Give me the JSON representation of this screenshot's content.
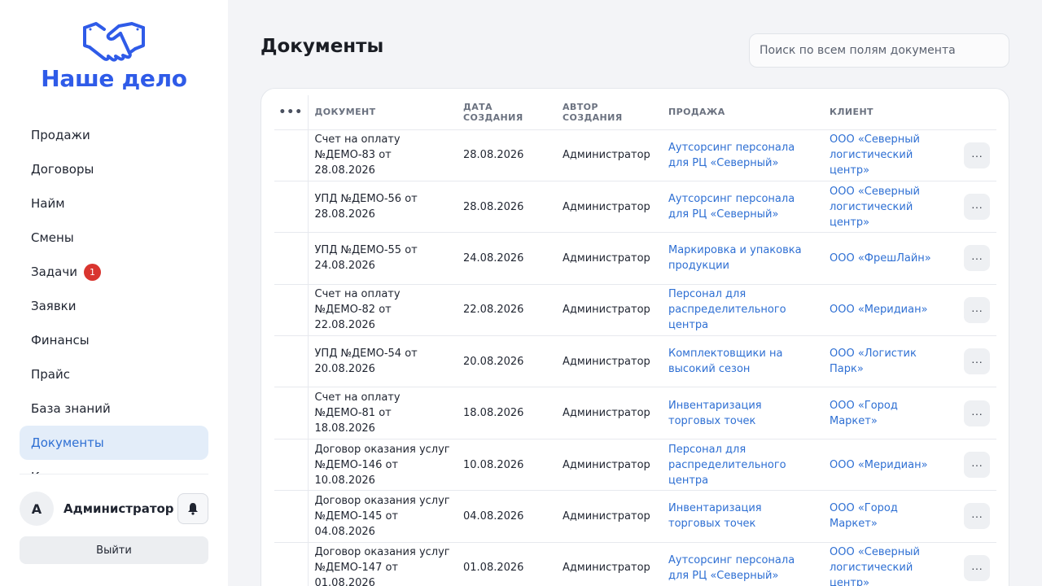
{
  "app": {
    "brand": "Наше дело"
  },
  "sidebar": {
    "items": [
      {
        "label": "Продажи"
      },
      {
        "label": "Договоры"
      },
      {
        "label": "Найм"
      },
      {
        "label": "Смены"
      },
      {
        "label": "Задачи",
        "badge": "1"
      },
      {
        "label": "Заявки"
      },
      {
        "label": "Финансы"
      },
      {
        "label": "Прайс"
      },
      {
        "label": "База знаний"
      },
      {
        "label": "Документы",
        "active": true
      },
      {
        "label": "К"
      }
    ],
    "user": {
      "initial": "А",
      "name": "Администратор"
    },
    "logout_label": "Выйти"
  },
  "page": {
    "title": "Документы",
    "search_placeholder": "Поиск по всем полям документа"
  },
  "table": {
    "menu_header": "•••",
    "columns": [
      "Документ",
      "Дата создания",
      "Автор создания",
      "Продажа",
      "Клиент"
    ],
    "rows": [
      {
        "document": "Счет на оплату №ДЕМО-83 от 28.08.2026",
        "date": "28.08.2026",
        "author": "Администратор",
        "sale": "Аутсорсинг персонала для РЦ «Северный»",
        "client": "ООО «Северный логистический центр»"
      },
      {
        "document": "УПД №ДЕМО-56 от 28.08.2026",
        "date": "28.08.2026",
        "author": "Администратор",
        "sale": "Аутсорсинг персонала для РЦ «Северный»",
        "client": "ООО «Северный логистический центр»"
      },
      {
        "document": "УПД №ДЕМО-55 от 24.08.2026",
        "date": "24.08.2026",
        "author": "Администратор",
        "sale": "Маркировка и упаковка продукции",
        "client": "ООО «ФрешЛайн»"
      },
      {
        "document": "Счет на оплату №ДЕМО-82 от 22.08.2026",
        "date": "22.08.2026",
        "author": "Администратор",
        "sale": "Персонал для распределительного центра",
        "client": "ООО «Меридиан»"
      },
      {
        "document": "УПД №ДЕМО-54 от 20.08.2026",
        "date": "20.08.2026",
        "author": "Администратор",
        "sale": "Комплектовщики на высокий сезон",
        "client": "ООО «Логистик Парк»"
      },
      {
        "document": "Счет на оплату №ДЕМО-81 от 18.08.2026",
        "date": "18.08.2026",
        "author": "Администратор",
        "sale": "Инвентаризация торговых точек",
        "client": "ООО «Город Маркет»"
      },
      {
        "document": "Договор оказания услуг №ДЕМО-146 от 10.08.2026",
        "date": "10.08.2026",
        "author": "Администратор",
        "sale": "Персонал для распределительного центра",
        "client": "ООО «Меридиан»"
      },
      {
        "document": "Договор оказания услуг №ДЕМО-145 от 04.08.2026",
        "date": "04.08.2026",
        "author": "Администратор",
        "sale": "Инвентаризация торговых точек",
        "client": "ООО «Город Маркет»"
      },
      {
        "document": "Договор оказания услуг №ДЕМО-147 от 01.08.2026",
        "date": "01.08.2026",
        "author": "Администратор",
        "sale": "Аутсорсинг персонала для РЦ «Северный»",
        "client": "ООО «Северный логистический центр»"
      }
    ],
    "row_action_label": "···"
  },
  "colors": {
    "brand": "#2f5be8",
    "link": "#2e6fd3",
    "active_bg": "#e3edf9",
    "badge": "#d9352f"
  },
  "icons": {
    "logo": "handshake-icon",
    "bell": "bell-icon",
    "more": "more-dots-icon"
  }
}
